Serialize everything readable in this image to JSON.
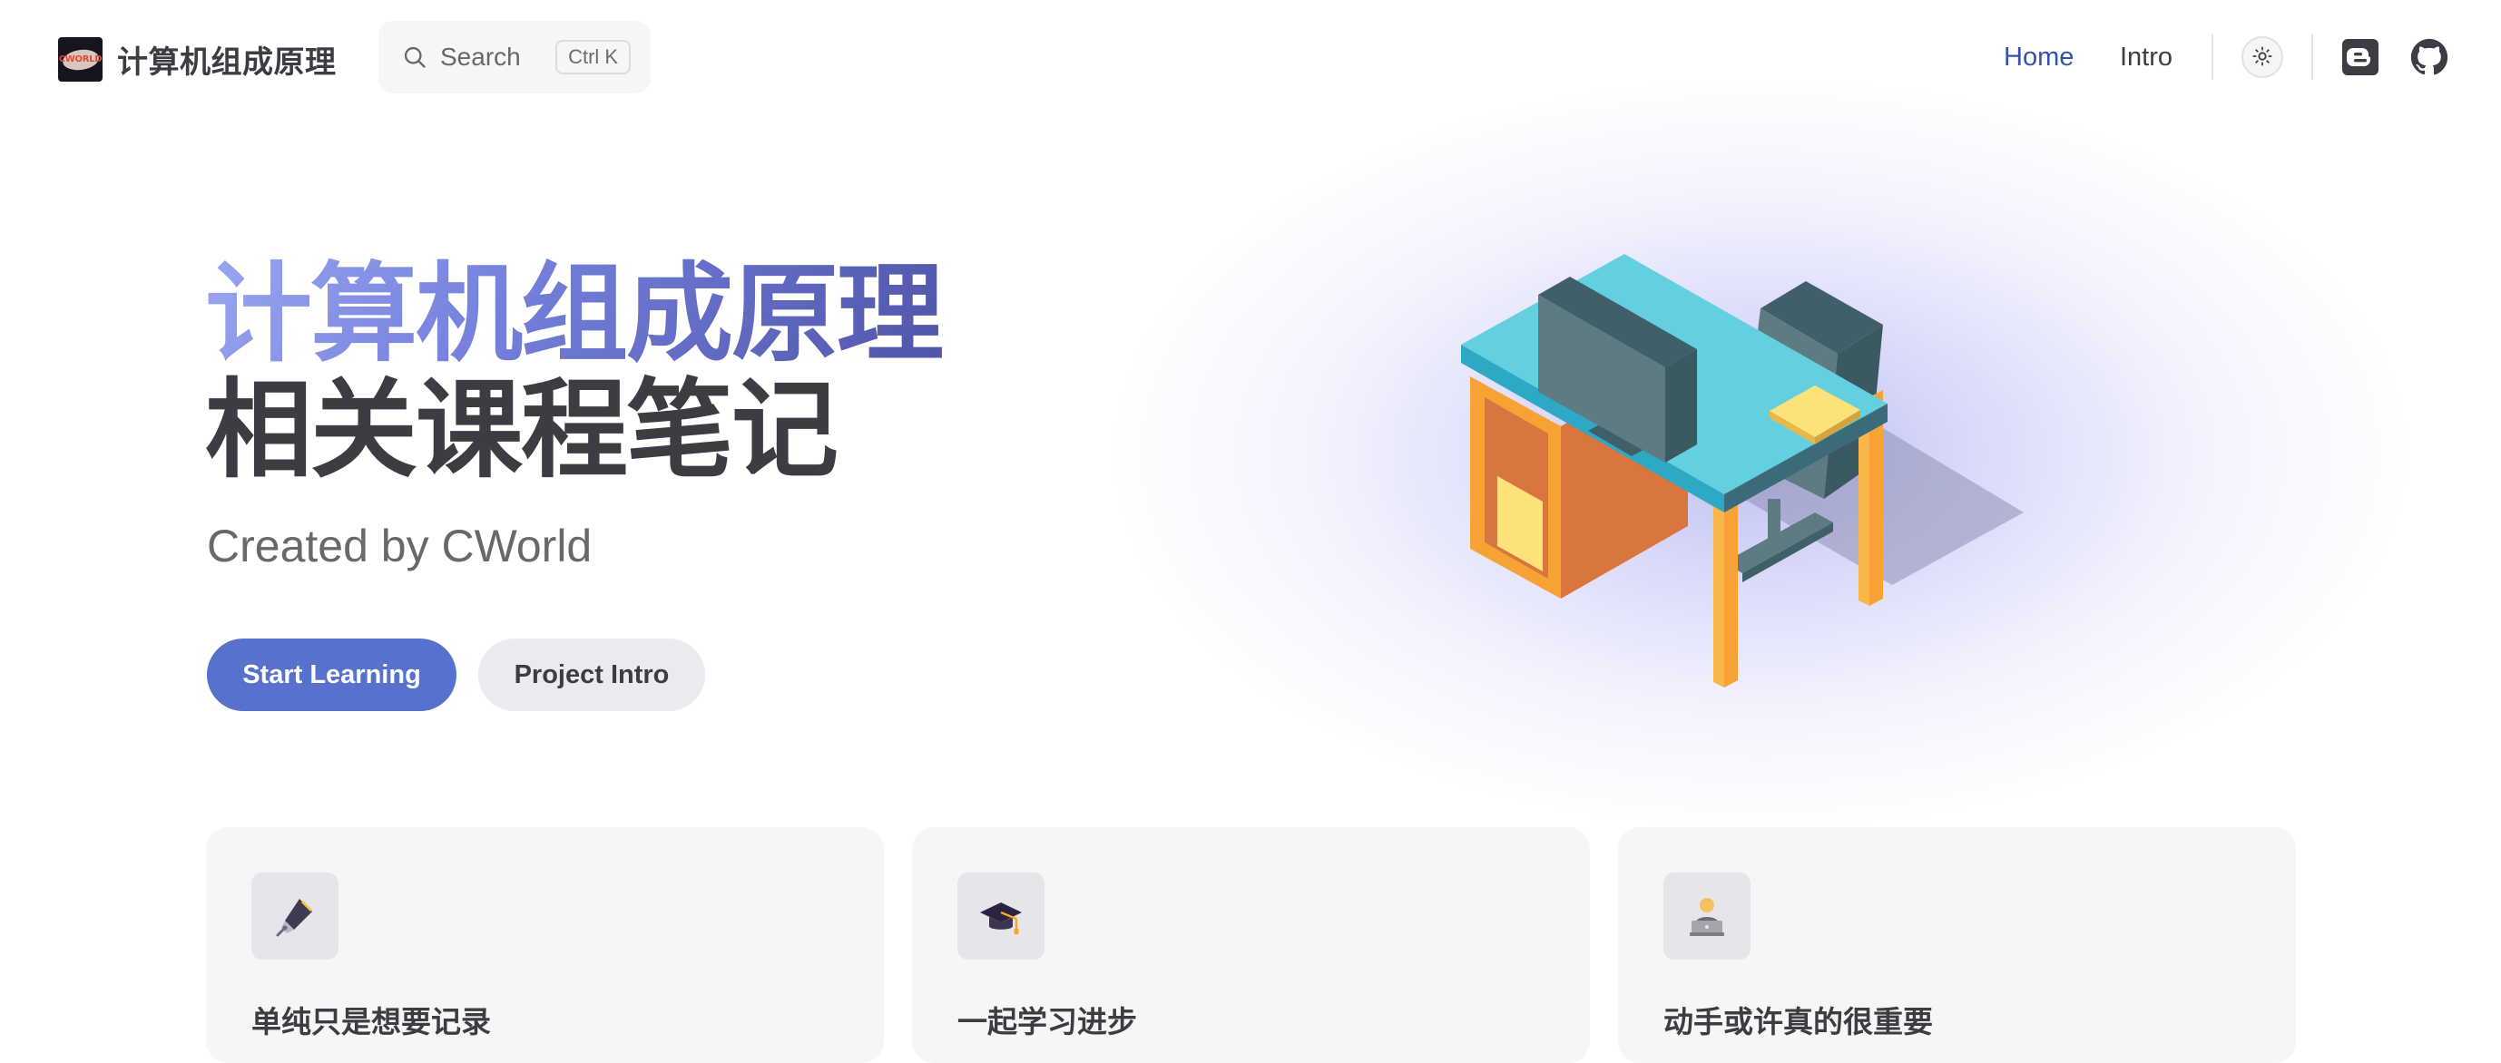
{
  "navbar": {
    "brand_title": "计算机组成原理",
    "logo_text": "CWORLD",
    "search": {
      "label": "Search",
      "shortcut_ctrl": "Ctrl",
      "shortcut_key": "K"
    },
    "links": [
      {
        "label": "Home",
        "active": true
      },
      {
        "label": "Intro",
        "active": false
      }
    ],
    "icons": [
      "sun-icon",
      "blogger-icon",
      "github-icon"
    ]
  },
  "hero": {
    "title": "计算机组成原理",
    "subtitle": "相关课程笔记",
    "tagline": "Created by CWorld",
    "actions": {
      "primary_label": "Start Learning",
      "secondary_label": "Project Intro"
    },
    "illustration": "isometric-desk-illustration"
  },
  "features": [
    {
      "icon": "fountain-pen-icon",
      "title": "单纯只是想要记录"
    },
    {
      "icon": "graduation-cap-icon",
      "title": "一起学习进步"
    },
    {
      "icon": "technologist-icon",
      "title": "动手或许真的很重要"
    }
  ],
  "colors": {
    "brand": "#3451b2",
    "primary_button": "#5672cd",
    "text": "#3c3c43",
    "muted_text": "#67676c",
    "card_bg": "#f6f6f7"
  }
}
